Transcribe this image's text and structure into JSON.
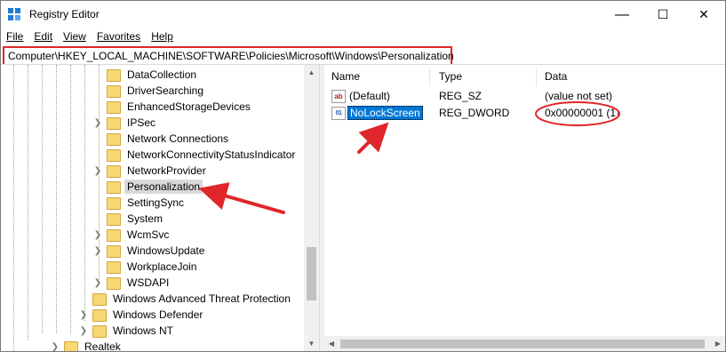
{
  "window": {
    "title": "Registry Editor",
    "minimize": "—",
    "maximize": "☐",
    "close": "✕"
  },
  "menu": [
    "File",
    "Edit",
    "View",
    "Favorites",
    "Help"
  ],
  "address": "Computer\\HKEY_LOCAL_MACHINE\\SOFTWARE\\Policies\\Microsoft\\Windows\\Personalization",
  "tree": {
    "items": [
      {
        "label": "DataCollection",
        "expandable": false
      },
      {
        "label": "DriverSearching",
        "expandable": false
      },
      {
        "label": "EnhancedStorageDevices",
        "expandable": false
      },
      {
        "label": "IPSec",
        "expandable": true
      },
      {
        "label": "Network Connections",
        "expandable": false
      },
      {
        "label": "NetworkConnectivityStatusIndicator",
        "expandable": false
      },
      {
        "label": "NetworkProvider",
        "expandable": true
      },
      {
        "label": "Personalization",
        "expandable": false,
        "selected": true
      },
      {
        "label": "SettingSync",
        "expandable": false
      },
      {
        "label": "System",
        "expandable": false
      },
      {
        "label": "WcmSvc",
        "expandable": true
      },
      {
        "label": "WindowsUpdate",
        "expandable": true
      },
      {
        "label": "WorkplaceJoin",
        "expandable": false
      },
      {
        "label": "WSDAPI",
        "expandable": true
      },
      {
        "label": "Windows Advanced Threat Protection",
        "expandable": false
      },
      {
        "label": "Windows Defender",
        "expandable": true
      },
      {
        "label": "Windows NT",
        "expandable": true
      },
      {
        "label": "Realtek",
        "expandable": true
      }
    ]
  },
  "values": {
    "headers": {
      "name": "Name",
      "type": "Type",
      "data": "Data"
    },
    "rows": [
      {
        "icon": "ab",
        "name": "(Default)",
        "type": "REG_SZ",
        "data": "(value not set)"
      },
      {
        "icon": "01",
        "name": "NoLockScreen",
        "type": "REG_DWORD",
        "data": "0x00000001 (1)",
        "selected": true
      }
    ]
  },
  "colors": {
    "annotation": "#e0262a",
    "selection": "#0078d7",
    "folder": "#f8d775"
  }
}
